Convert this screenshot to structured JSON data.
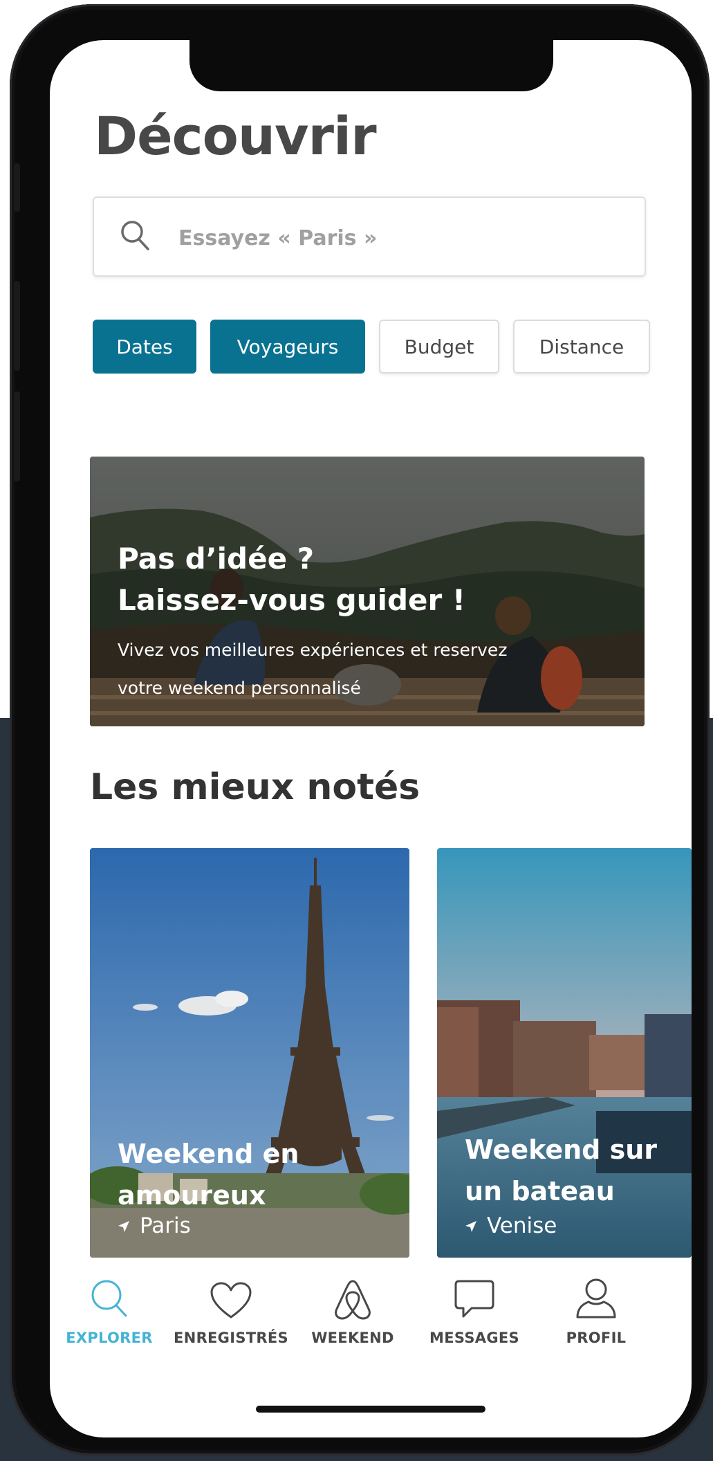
{
  "header": {
    "title": "Découvrir"
  },
  "search": {
    "placeholder": "Essayez « Paris »"
  },
  "filters": [
    {
      "label": "Dates",
      "active": true
    },
    {
      "label": "Voyageurs",
      "active": true
    },
    {
      "label": "Budget",
      "active": false
    },
    {
      "label": "Distance",
      "active": false
    }
  ],
  "hero": {
    "title_line1": "Pas d’idée ?",
    "title_line2": "Laissez-vous guider !",
    "subtitle_line1": "Vivez vos meilleures expériences et reservez",
    "subtitle_line2": "votre weekend personnalisé"
  },
  "top_rated": {
    "title": "Les mieux notés",
    "cards": [
      {
        "title_line1": "Weekend en",
        "title_line2": "amoureux",
        "location": "Paris"
      },
      {
        "title_line1": "Weekend sur",
        "title_line2": "un bateau",
        "location": "Venise"
      }
    ]
  },
  "tabbar": {
    "items": [
      {
        "label": "EXPLORER",
        "icon": "search-icon",
        "active": true
      },
      {
        "label": "ENREGISTRÉS",
        "icon": "heart-icon",
        "active": false
      },
      {
        "label": "WEEKEND",
        "icon": "airbnb-logo-icon",
        "active": false
      },
      {
        "label": "MESSAGES",
        "icon": "chat-bubble-icon",
        "active": false
      },
      {
        "label": "PROFIL",
        "icon": "user-icon",
        "active": false
      }
    ]
  },
  "colors": {
    "accent": "#0a7291",
    "tab_active": "#45b3d3",
    "text_dark": "#484848"
  }
}
